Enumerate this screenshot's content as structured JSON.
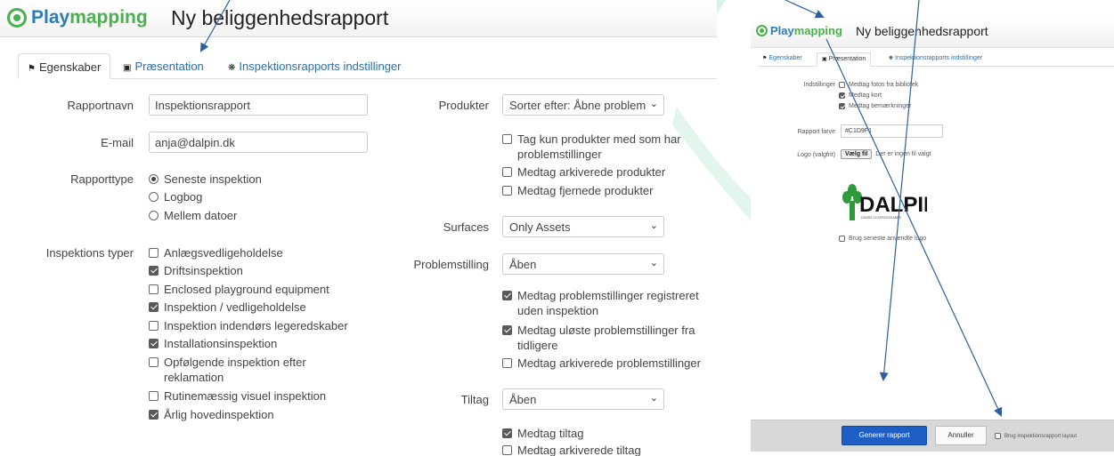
{
  "colors": {
    "brand_blue": "#2b7fb8",
    "brand_green": "#4caf50",
    "link": "#2a6fb0",
    "primary_button": "#1d5fc6",
    "annotation_arrow": "#2d5fa0",
    "decor_mint": "#d9f3e8"
  },
  "left": {
    "brand": {
      "part1": "Play",
      "part2": "mapping"
    },
    "title": "Ny beliggenhedsrapport",
    "tabs": [
      {
        "label": "Egenskaber",
        "icon": "tag-icon",
        "active": true
      },
      {
        "label": "Præsentation",
        "icon": "camera-icon",
        "active": false
      },
      {
        "label": "Inspektionsrapports indstillinger",
        "icon": "gear-icon",
        "active": false
      }
    ],
    "form": {
      "report_name": {
        "label": "Rapportnavn",
        "value": "Inspektionsrapport"
      },
      "email": {
        "label": "E-mail",
        "value": "anja@dalpin.dk"
      },
      "report_type": {
        "label": "Rapporttype",
        "options": [
          {
            "label": "Seneste inspektion",
            "selected": true
          },
          {
            "label": "Logbog",
            "selected": false
          },
          {
            "label": "Mellem datoer",
            "selected": false
          }
        ]
      },
      "inspection_types": {
        "label": "Inspektions typer",
        "options": [
          {
            "label": "Anlægsvedligeholdelse",
            "checked": false
          },
          {
            "label": "Driftsinspektion",
            "checked": true
          },
          {
            "label": "Enclosed playground equipment",
            "checked": false
          },
          {
            "label": "Inspektion / vedligeholdelse",
            "checked": true
          },
          {
            "label": "Inspektion indendørs legeredskaber",
            "checked": false
          },
          {
            "label": "Installationsinspektion",
            "checked": true
          },
          {
            "label": "Opfølgende inspektion efter",
            "label2": "reklamation",
            "checked": false
          },
          {
            "label": "Rutinemæssig visuel inspektion",
            "checked": false
          },
          {
            "label": "Årlig hovedinspektion",
            "checked": true
          }
        ]
      },
      "products": {
        "label": "Produkter",
        "select_value": "Sorter efter: Åbne problem",
        "options": [
          {
            "label": "Tag kun produkter med som har",
            "label2": "problemstillinger",
            "checked": false
          },
          {
            "label": "Medtag arkiverede produkter",
            "checked": false
          },
          {
            "label": "Medtag fjernede produkter",
            "checked": false
          }
        ]
      },
      "surfaces": {
        "label": "Surfaces",
        "select_value": "Only Assets"
      },
      "problems": {
        "label": "Problemstilling",
        "select_value": "Åben",
        "options": [
          {
            "label": "Medtag problemstillinger registreret",
            "label2": "uden inspektion",
            "checked": true
          },
          {
            "label": "Medtag uløste problemstillinger fra",
            "label2": "tidligere",
            "checked": true
          },
          {
            "label": "Medtag arkiverede problemstillinger",
            "checked": false
          }
        ]
      },
      "measures": {
        "label": "Tiltag",
        "select_value": "Åben",
        "options": [
          {
            "label": "Medtag tiltag",
            "checked": true
          },
          {
            "label": "Medtag arkiverede tiltag",
            "checked": false
          }
        ]
      }
    }
  },
  "right": {
    "brand": {
      "part1": "Play",
      "part2": "mapping"
    },
    "title": "Ny beliggenhedsrapport",
    "tabs": [
      {
        "label": "Egenskaber",
        "icon": "tag-icon",
        "active": false
      },
      {
        "label": "Præsentation",
        "icon": "camera-icon",
        "active": true
      },
      {
        "label": "Inspektionsrapports indstillinger",
        "icon": "gear-icon",
        "active": false
      }
    ],
    "settings": {
      "label": "Indstillinger",
      "options": [
        {
          "label": "Medtag fotos fra bibliotek",
          "checked": false
        },
        {
          "label": "Medtag kort",
          "checked": true
        },
        {
          "label": "Medtag bemærkninger",
          "checked": true
        }
      ]
    },
    "report_color": {
      "label": "Rapport farve",
      "value": "#C1D9F1"
    },
    "logo": {
      "label": "Logo (valgfrit)",
      "button": "Vælg fil",
      "status": "Der er ingen fil valgt",
      "image_text": "DALPIN",
      "image_subtext": "DANSK LEGEREDSKABER"
    },
    "use_last_logo": {
      "label": "Brug seneste anvendte logo",
      "checked": false
    },
    "footer": {
      "generate": "Generer rapport",
      "cancel": "Annuller",
      "use_layout": {
        "label": "Brug inspektionsrapport layout",
        "checked": false
      }
    }
  }
}
